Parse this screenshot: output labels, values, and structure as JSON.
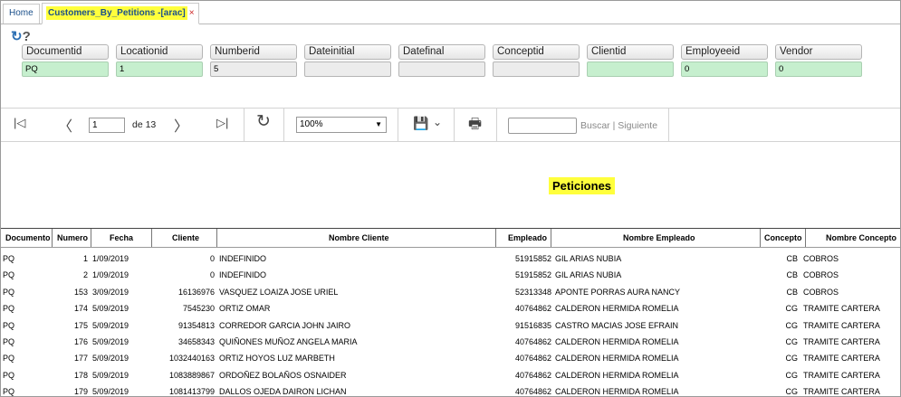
{
  "tabs": {
    "home_label": "Home",
    "active_label": "Customers_By_Petitions -[arac]",
    "close_glyph": "×"
  },
  "tools": {
    "refresh_glyph": "↻",
    "help_glyph": "?"
  },
  "params": [
    {
      "label": "Documentid",
      "value": "PQ",
      "filled": true
    },
    {
      "label": "Locationid",
      "value": "1",
      "filled": true
    },
    {
      "label": "Numberid",
      "value": "5",
      "filled": false
    },
    {
      "label": "Dateinitial",
      "value": "",
      "filled": false
    },
    {
      "label": "Datefinal",
      "value": "",
      "filled": false
    },
    {
      "label": "Conceptid",
      "value": "",
      "filled": false
    },
    {
      "label": "Clientid",
      "value": "",
      "filled": true
    },
    {
      "label": "Employeeid",
      "value": "0",
      "filled": true
    },
    {
      "label": "Vendor",
      "value": "0",
      "filled": true
    }
  ],
  "toolbar": {
    "first_glyph": "|◁",
    "prev_glyph": "〈",
    "page_value": "1",
    "page_of": "de 13",
    "next_glyph": "〉",
    "last_glyph": "▷|",
    "refresh_glyph": "↻",
    "zoom_value": "100%",
    "zoom_caret": "▼",
    "save_glyph": "💾",
    "save_caret": "⌄",
    "print_glyph": "🖶",
    "search_label": "Buscar",
    "search_sep": "|",
    "next_label": "Siguiente"
  },
  "report": {
    "title": "Peticiones",
    "columns": [
      "Documento",
      "Numero",
      "Fecha",
      "Cliente",
      "Nombre Cliente",
      "Empleado",
      "Nombre Empleado",
      "Concepto",
      "Nombre Concepto"
    ],
    "rows": [
      [
        "PQ",
        "1",
        "1/09/2019",
        "0",
        "INDEFINIDO",
        "51915852",
        "GIL ARIAS NUBIA",
        "CB",
        "COBROS"
      ],
      [
        "PQ",
        "2",
        "1/09/2019",
        "0",
        "INDEFINIDO",
        "51915852",
        "GIL ARIAS NUBIA",
        "CB",
        "COBROS"
      ],
      [
        "PQ",
        "153",
        "3/09/2019",
        "16136976",
        "VASQUEZ LOAIZA JOSE URIEL",
        "52313348",
        "APONTE PORRAS AURA NANCY",
        "CB",
        "COBROS"
      ],
      [
        "PQ",
        "174",
        "5/09/2019",
        "7545230",
        "ORTIZ  OMAR",
        "40764862",
        "CALDERON  HERMIDA ROMELIA",
        "CG",
        "TRAMITE CARTERA"
      ],
      [
        "PQ",
        "175",
        "5/09/2019",
        "91354813",
        "CORREDOR GARCIA JOHN JAIRO",
        "91516835",
        "CASTRO  MACIAS JOSE EFRAIN",
        "CG",
        "TRAMITE CARTERA"
      ],
      [
        "PQ",
        "176",
        "5/09/2019",
        "34658343",
        "QUIÑONES MUÑOZ ANGELA MARIA",
        "40764862",
        "CALDERON  HERMIDA ROMELIA",
        "CG",
        "TRAMITE CARTERA"
      ],
      [
        "PQ",
        "177",
        "5/09/2019",
        "1032440163",
        "ORTIZ HOYOS LUZ MARBETH",
        "40764862",
        "CALDERON  HERMIDA ROMELIA",
        "CG",
        "TRAMITE CARTERA"
      ],
      [
        "PQ",
        "178",
        "5/09/2019",
        "1083889867",
        "ORDOÑEZ BOLAÑOS OSNAIDER",
        "40764862",
        "CALDERON  HERMIDA ROMELIA",
        "CG",
        "TRAMITE CARTERA"
      ],
      [
        "PQ",
        "179",
        "5/09/2019",
        "1081413799",
        "DALLOS OJEDA DAIRON LICHAN",
        "40764862",
        "CALDERON  HERMIDA ROMELIA",
        "CG",
        "TRAMITE CARTERA"
      ]
    ]
  }
}
